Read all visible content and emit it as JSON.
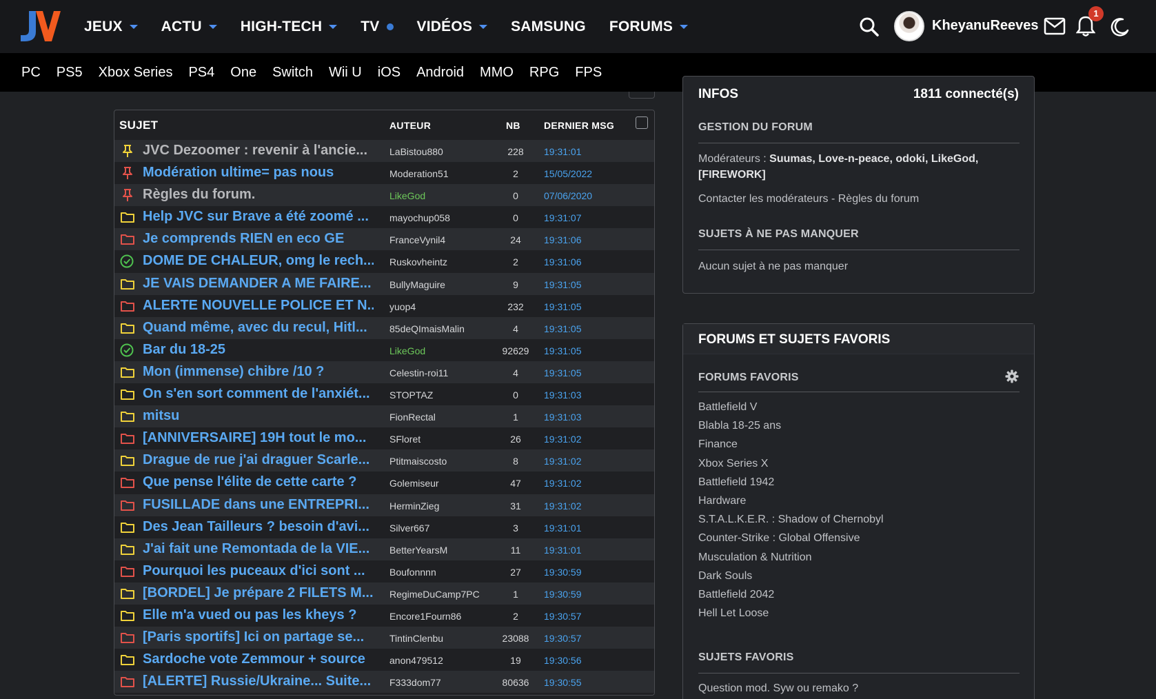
{
  "header": {
    "logo_text": "JV",
    "nav": [
      {
        "label": "JEUX",
        "marker": "caret"
      },
      {
        "label": "ACTU",
        "marker": "caret"
      },
      {
        "label": "HIGH-TECH",
        "marker": "caret"
      },
      {
        "label": "TV",
        "marker": "dot"
      },
      {
        "label": "VIDÉOS",
        "marker": "caret"
      },
      {
        "label": "SAMSUNG",
        "marker": "none"
      },
      {
        "label": "FORUMS",
        "marker": "caret"
      }
    ],
    "username": "KheyanuReeves",
    "notification_count": "1",
    "icons": [
      "search-icon",
      "mail-icon",
      "bell-icon",
      "moon-icon"
    ]
  },
  "subnav": [
    "PC",
    "PS5",
    "Xbox Series",
    "PS4",
    "One",
    "Switch",
    "Wii U",
    "iOS",
    "Android",
    "MMO",
    "RPG",
    "FPS"
  ],
  "topics": {
    "columns": {
      "subject": "SUJET",
      "author": "AUTEUR",
      "nb": "NB",
      "last": "DERNIER MSG"
    },
    "rows": [
      {
        "icon": "pin-yellow",
        "title": "JVC Dezoomer : revenir à l'ancie...",
        "author": "LaBistou880",
        "nb": "228",
        "last": "19:31:01",
        "title_style": "grey",
        "author_style": "normal"
      },
      {
        "icon": "pin-red",
        "title": "Modération ultime= pas nous",
        "author": "Moderation51",
        "nb": "2",
        "last": "15/05/2022",
        "title_style": "link",
        "author_style": "normal"
      },
      {
        "icon": "pin-red",
        "title": "Règles du forum.",
        "author": "LikeGod",
        "nb": "0",
        "last": "07/06/2020",
        "title_style": "grey",
        "author_style": "green"
      },
      {
        "icon": "folder-yellow",
        "title": "Help JVC sur Brave a été zoomé ...",
        "author": "mayochup058",
        "nb": "0",
        "last": "19:31:07",
        "title_style": "link",
        "author_style": "normal"
      },
      {
        "icon": "folder-red",
        "title": "Je comprends RIEN en eco GE",
        "author": "FranceVynil4",
        "nb": "24",
        "last": "19:31:06",
        "title_style": "link",
        "author_style": "normal"
      },
      {
        "icon": "check-green",
        "title": "DOME DE CHALEUR, omg le rech...",
        "author": "Ruskovheintz",
        "nb": "2",
        "last": "19:31:06",
        "title_style": "link",
        "author_style": "normal"
      },
      {
        "icon": "folder-yellow",
        "title": "JE VAIS DEMANDER A ME FAIRE...",
        "author": "BullyMaguire",
        "nb": "9",
        "last": "19:31:05",
        "title_style": "link",
        "author_style": "normal"
      },
      {
        "icon": "folder-red",
        "title": "ALERTE NOUVELLE POLICE ET N...",
        "author": "yuop4",
        "nb": "232",
        "last": "19:31:05",
        "title_style": "link",
        "author_style": "normal"
      },
      {
        "icon": "folder-yellow",
        "title": "Quand même, avec du recul, Hitl...",
        "author": "85deQImaisMalin",
        "nb": "4",
        "last": "19:31:05",
        "title_style": "link",
        "author_style": "normal"
      },
      {
        "icon": "check-green",
        "title": "Bar du 18-25",
        "author": "LikeGod",
        "nb": "92629",
        "last": "19:31:05",
        "title_style": "link",
        "author_style": "green"
      },
      {
        "icon": "folder-yellow",
        "title": "Mon (immense) chibre /10 ?",
        "author": "Celestin-roi11",
        "nb": "4",
        "last": "19:31:05",
        "title_style": "link",
        "author_style": "normal"
      },
      {
        "icon": "folder-yellow",
        "title": "On s'en sort comment de l'anxiét...",
        "author": "STOPTAZ",
        "nb": "0",
        "last": "19:31:03",
        "title_style": "link",
        "author_style": "normal"
      },
      {
        "icon": "folder-yellow",
        "title": "mitsu",
        "author": "FionRectal",
        "nb": "1",
        "last": "19:31:03",
        "title_style": "link",
        "author_style": "normal"
      },
      {
        "icon": "folder-red",
        "title": "[ANNIVERSAIRE] 19H tout le mo...",
        "author": "SFloret",
        "nb": "26",
        "last": "19:31:02",
        "title_style": "link",
        "author_style": "normal"
      },
      {
        "icon": "folder-yellow",
        "title": "Drague de rue j'ai draguer Scarle...",
        "author": "Ptitmaiscosto",
        "nb": "8",
        "last": "19:31:02",
        "title_style": "link",
        "author_style": "normal"
      },
      {
        "icon": "folder-red",
        "title": "Que pense l'élite de cette carte ?",
        "author": "Golemiseur",
        "nb": "47",
        "last": "19:31:02",
        "title_style": "link",
        "author_style": "normal"
      },
      {
        "icon": "folder-red",
        "title": "FUSILLADE dans une ENTREPRI...",
        "author": "HerminZieg",
        "nb": "31",
        "last": "19:31:02",
        "title_style": "link",
        "author_style": "normal"
      },
      {
        "icon": "folder-yellow",
        "title": "Des Jean Tailleurs ? besoin d'avi...",
        "author": "Silver667",
        "nb": "3",
        "last": "19:31:01",
        "title_style": "link",
        "author_style": "normal"
      },
      {
        "icon": "folder-yellow",
        "title": "J'ai fait une Remontada de la VIE...",
        "author": "BetterYearsM",
        "nb": "11",
        "last": "19:31:01",
        "title_style": "link",
        "author_style": "normal"
      },
      {
        "icon": "folder-red",
        "title": "Pourquoi les puceaux d'ici sont ...",
        "author": "Boufonnnn",
        "nb": "27",
        "last": "19:30:59",
        "title_style": "link",
        "author_style": "normal"
      },
      {
        "icon": "folder-yellow",
        "title": "[BORDEL] Je prépare 2 FILETS M...",
        "author": "RegimeDuCamp7PC",
        "nb": "1",
        "last": "19:30:59",
        "title_style": "link",
        "author_style": "normal"
      },
      {
        "icon": "folder-yellow",
        "title": "Elle m'a vued ou pas les kheys ?",
        "author": "Encore1Fourn86",
        "nb": "2",
        "last": "19:30:57",
        "title_style": "link",
        "author_style": "normal"
      },
      {
        "icon": "folder-red",
        "title": "[Paris sportifs] Ici on partage se...",
        "author": "TintinClenbu",
        "nb": "23088",
        "last": "19:30:57",
        "title_style": "link",
        "author_style": "normal"
      },
      {
        "icon": "folder-yellow",
        "title": "Sardoche vote Zemmour + source",
        "author": "anon479512",
        "nb": "19",
        "last": "19:30:56",
        "title_style": "link",
        "author_style": "normal"
      },
      {
        "icon": "folder-red",
        "title": "[ALERTE] Russie/Ukraine... Suite...",
        "author": "F333dom77",
        "nb": "80636",
        "last": "19:30:55",
        "title_style": "link",
        "author_style": "normal"
      }
    ]
  },
  "infos": {
    "title": "INFOS",
    "connected": "1811 connecté(s)",
    "gestion_title": "GESTION DU FORUM",
    "moderators_label": "Modérateurs :",
    "moderators": "Suumas, Love-n-peace, odoki, LikeGod,",
    "moderators_cont": "[FIREWORK]",
    "contact_link": "Contacter les modérateurs",
    "separator": " - ",
    "rules_link": "Règles du forum",
    "not_miss_title": "SUJETS À NE PAS MANQUER",
    "not_miss_text": "Aucun sujet à ne pas manquer"
  },
  "favorites": {
    "title": "FORUMS ET SUJETS FAVORIS",
    "forums_title": "FORUMS FAVORIS",
    "forums": [
      "Battlefield V",
      "Blabla 18-25 ans",
      "Finance",
      "Xbox Series X",
      "Battlefield 1942",
      "Hardware",
      "S.T.A.L.K.E.R. : Shadow of Chernobyl",
      "Counter-Strike : Global Offensive",
      "Musculation & Nutrition",
      "Dark Souls",
      "Battlefield 2042",
      "Hell Let Loose"
    ],
    "topics_title": "SUJETS FAVORIS",
    "topics": [
      "Question mod. Syw ou remako ?"
    ]
  },
  "colors": {
    "link": "#5aa9f2",
    "author_green": "#6dc85a",
    "folder_yellow": "#f0d23a",
    "folder_red": "#e2524a",
    "check_green": "#4fc24f",
    "accent_blue": "#3a7bd5",
    "logo_orange": "#f25a1e"
  }
}
